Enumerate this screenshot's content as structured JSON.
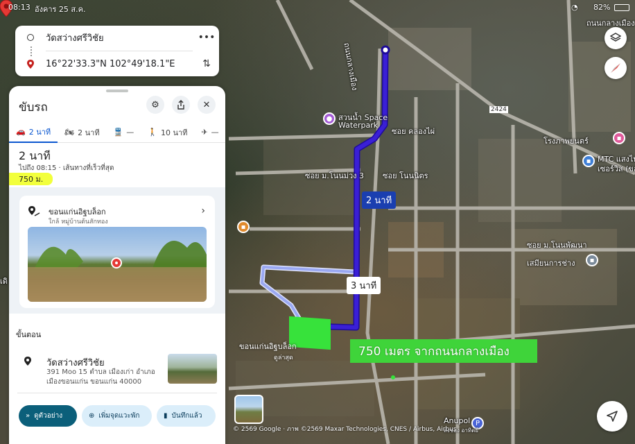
{
  "status_bar": {
    "time": "08:13",
    "date": "อังคาร 25 ส.ค.",
    "battery": "82%"
  },
  "directions": {
    "origin": "วัดสว่างศรีวิชัย",
    "destination": "16°22'33.3\"N 102°49'18.1\"E",
    "more_icon": "more-vert-icon",
    "swap_icon": "swap-icon"
  },
  "sheet": {
    "title": "ขับรถ",
    "modes": [
      {
        "icon": "car-icon",
        "label": "2 นาที",
        "active": true
      },
      {
        "icon": "motorcycle-icon",
        "label": "2 นาที",
        "active": false
      },
      {
        "icon": "transit-icon",
        "label": "—",
        "active": false
      },
      {
        "icon": "walk-icon",
        "label": "10 นาที",
        "active": false
      },
      {
        "icon": "flight-icon",
        "label": "—",
        "active": false
      }
    ],
    "route_time": "2 นาที",
    "route_sub": "ไปถึง 08:15 · เส้นทางที่เร็วที่สุด",
    "route_distance": "750 ม.",
    "place": {
      "name": "ขอนแก่นอิฐบล็อก",
      "subtitle": "ใกล้ หมู่บ้านต้นสักทอง"
    },
    "steps_title": "ขั้นตอน",
    "step": {
      "name": "วัดสว่างศรีวิชัย",
      "address_line1": "391 Moo 15 ตำบล เมืองเก่า อำเภอ",
      "address_line2": "เมืองขอนแก่น ขอนแก่น 40000"
    },
    "actions": {
      "preview": "ดูตัวอย่าง",
      "add_stop": "เพิ่มจุดแวะพัก",
      "saved": "บันทึกแล้ว"
    }
  },
  "map": {
    "route_color": "#3a1fd6",
    "alt_route_color": "#aab6f5",
    "highlight_color": "#37e23b",
    "primary_duration": "2 นาที",
    "alt_duration": "3 นาที",
    "annotation": "750 เมตร จากถนนกลางเมือง",
    "destination_label": "ขอนแก่นอิฐบล็อก",
    "destination_sublabel": "ดูล่าสุด",
    "labels": {
      "road_klangmuang": "ถนนกลางเมือง",
      "waterpark_1": "สวนน้ำ Space",
      "waterpark_2": "Waterpark",
      "soi_khlongpai": "ซอย คลองไผ่",
      "soi_muang": "ซอย ม.โนนม่วง 3",
      "soi_nonnitat": "ซอย โนนนิตร",
      "road_2424": "2424",
      "hotel": "โรงภาพยนตร์",
      "mtc_1": "MTC แสงไพ",
      "mtc_2": "เซอร์วิส (ขอ",
      "clinic": "เสมียนการช่าง",
      "soi_phatthana": "ซอย ม.โนนพัฒนา",
      "anupol": "Anupol",
      "anupol_sub": "ส่งของ อาทิตย์",
      "side_label": "เดิ",
      "road_top_right": "ถนนกลางเมือง"
    },
    "copyright": "© 2569 Google · ภาพ ©2569 Maxar Technologies, CNES / Airbus, Airbus"
  }
}
